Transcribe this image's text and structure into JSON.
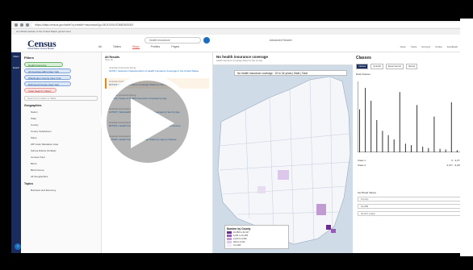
{
  "browser": {
    "url": "https://data.census.gov/table?q=health+insurance&g=040XX00US36$0500000"
  },
  "gov_banner": "An official website of the United States government",
  "header": {
    "logo": "Census",
    "logo_sub": "United States Census Bureau",
    "search_value": "health insurance",
    "advanced_search": "Advanced Search",
    "tabs": [
      "All",
      "Tables",
      "Maps",
      "Profiles",
      "Pages"
    ],
    "active_tab": "Maps",
    "tools": [
      "Geos",
      "Years",
      "Surveys",
      "Codes",
      "Feedback"
    ]
  },
  "rail": {
    "items": [
      "Filters",
      "Search"
    ]
  },
  "filters": {
    "title": "Filters",
    "chips": {
      "green": "Health Insurance",
      "blue1": "All Counties within New York",
      "blue2": "Washington County, New York",
      "blue3": "Richmond County, New York",
      "red": "Clear Search / Filters"
    },
    "search_placeholder": "Search for a Filter or Table",
    "group_label": "Geographies",
    "geo_items": [
      "Nation",
      "State",
      "County",
      "County Subdivision",
      "Place",
      "ZIP Code Tabulation Area",
      "School District (Unified)",
      "Census Tract",
      "Block",
      "Block Group",
      "All Geographies"
    ],
    "topics_label": "Topics",
    "topics_item": "Business and Economy"
  },
  "results": {
    "header": "All Results",
    "view_label": "View: All",
    "cards": [
      {
        "source": "American Community Survey",
        "title": "S2701 | Selected Characteristics of Health Insurance Coverage in the United States"
      },
      {
        "source": "American Community Survey",
        "title": "B27001 | Health Insurance Coverage Status by Sex by Age",
        "selected": true
      },
      {
        "source": "American Community Survey",
        "title": "B27010 | Types of Health Insurance Coverage by Age"
      },
      {
        "source": "American Community Survey",
        "title": "C27007 | Medicaid/Means-Tested Public Coverage by Sex by Age"
      },
      {
        "source": "American Community Survey",
        "title": "B27015 | Health Insurance Coverage Status by Household Income"
      },
      {
        "source": "American Community Survey",
        "title": "B27020 | Health Insurance Coverage Status by Age by Nativity"
      }
    ]
  },
  "map": {
    "title": "No health insurance coverage",
    "subtitle": "Health Insurance Coverage Status by Sex by Age",
    "banner": "No health insurance coverage : 19 to 34 years | Male | Total",
    "legend_title": "Number by County",
    "legend_rows": [
      {
        "label": "10,256 to 31,017",
        "color": "#6a2c8f"
      },
      {
        "label": "6,251 to 10,255",
        "color": "#9b59b6"
      },
      {
        "label": "2,163 to 6,250",
        "color": "#c39bd3"
      },
      {
        "label": "463 to 2,162",
        "color": "#dcc6ea"
      },
      {
        "label": "0 to 462",
        "color": "#f2eaf8"
      }
    ]
  },
  "classes": {
    "title": "Classes",
    "tabs": [
      "Classes",
      "Quantile",
      "Equal Interval",
      "Natural"
    ],
    "active_tab": "Classes",
    "color_label": "Data Classes",
    "bar_values": [
      60,
      90,
      72,
      45,
      30,
      24,
      18,
      84,
      12,
      10,
      66,
      8,
      6,
      50,
      5,
      4,
      70,
      3
    ],
    "rows": [
      {
        "label": "Class 1",
        "value": "0 - 3,277"
      },
      {
        "label": "Class 2",
        "value": "3,277 - 9,245"
      }
    ],
    "lower_title": "Set Break Values",
    "fields": [
      "0 (min)",
      "10,256",
      "31,017 (max)"
    ],
    "colors": {
      "accent": "#1a2c5b",
      "bars": "#333333"
    }
  },
  "help_label": "?"
}
